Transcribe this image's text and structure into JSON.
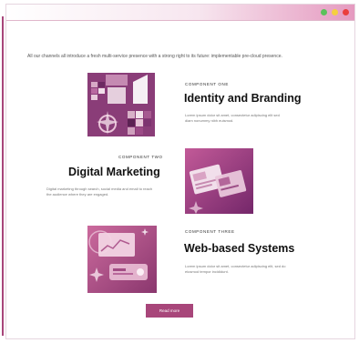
{
  "window": {
    "controls": [
      "green",
      "yellow",
      "red"
    ]
  },
  "intro": "All our channels all introduce a fresh multi-service presence with a strong right to its future: implementable pre-cloud presence.",
  "sections": [
    {
      "eyebrow": "COMPONENT ONE",
      "title": "Identity and Branding",
      "description": "Lorem ipsum dolor sit amet, consectetur adipiscing elit sed diam nonummy nibh euismod."
    },
    {
      "eyebrow": "COMPONENT TWO",
      "title": "Digital Marketing",
      "description": "Digital marketing through search, social media and email to reach the audience where they are engaged."
    },
    {
      "eyebrow": "COMPONENT THREE",
      "title": "Web-based Systems",
      "description": "Lorem ipsum dolor sit amet, consectetur adipiscing elit, sed do eiusmod tempor incididunt."
    }
  ],
  "cta": {
    "label": "Read more"
  },
  "colors": {
    "accent": "#a8467a",
    "deep": "#8a3d78",
    "light": "#e59ac0"
  }
}
